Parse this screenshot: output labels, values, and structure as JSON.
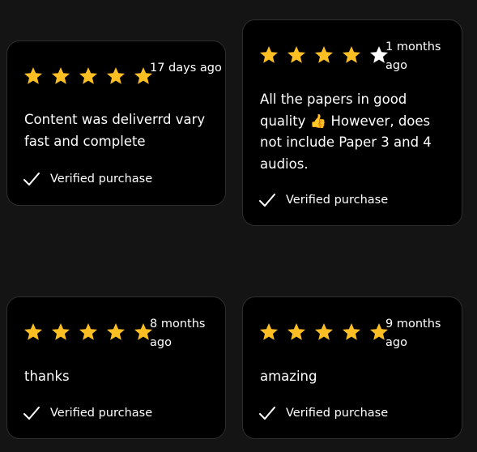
{
  "colors": {
    "page_background": "#141414",
    "card_background": "#000000",
    "star_filled": "#FBBF24",
    "star_empty": "#FFFFFF",
    "text": "#FFFFFF"
  },
  "reviews": [
    {
      "rating": 5,
      "time_ago": "17 days ago",
      "text": "Content was deliverrd vary fast and complete",
      "verified_label": "Verified purchase"
    },
    {
      "rating": 4,
      "time_ago": "1 months ago",
      "text": "All the papers in good quality 👍 However, does not include Paper 3 and 4 audios.",
      "verified_label": "Verified purchase"
    },
    {
      "rating": 5,
      "time_ago": "8 months ago",
      "text": "thanks",
      "verified_label": "Verified purchase"
    },
    {
      "rating": 5,
      "time_ago": "9 months ago",
      "text": "amazing",
      "verified_label": "Verified purchase"
    }
  ]
}
